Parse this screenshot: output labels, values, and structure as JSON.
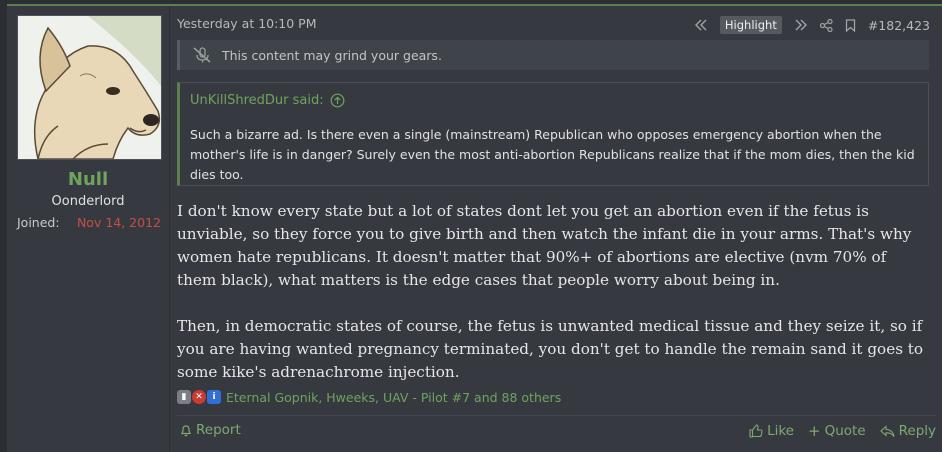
{
  "user": {
    "name": "Null",
    "title": "Oonderlord",
    "joined_label": "Joined:",
    "joined_date": "Nov 14, 2012",
    "avatar_icon": "cartoon-dog-avatar"
  },
  "post": {
    "timestamp": "Yesterday at 10:10 PM",
    "highlight_label": "Highlight",
    "post_number": "#182,423",
    "trigger_warning": "This content may grind your gears.",
    "quote": {
      "author": "UnKillShredDur said:",
      "text": "Such a bizarre ad. Is there even a single (mainstream) Republican who opposes emergency abortion when the mother's life is in danger? Surely even the most anti-abortion Republicans realize that if the mom dies, then the kid dies too."
    },
    "paragraphs": [
      "I don't know every state but a lot of states dont let you get an abortion even if the fetus is unviable, so they force you to give birth and then watch the infant die in your arms. That's why women hate republicans. It doesn't matter that 90%+ of abortions are elective (nvm 70% of them black), what matters is the edge cases that people worry about being in.",
      "Then, in democratic states of course, the fetus is unwanted medical tissue and they seize it, so if you are having wanted pregnancy terminated, you don't get to handle the remain sand it goes to some kike's adrenachrome injection."
    ],
    "reactions_text": "Eternal Gopnik, Hweeks, UAV - Pilot #7 and 88 others",
    "report_label": "Report",
    "like_label": "Like",
    "quote_label": "Quote",
    "reply_label": "Reply"
  },
  "colors": {
    "accent_green": "#6fa35e",
    "joined_red": "#c84d40",
    "background": "#363a40"
  }
}
